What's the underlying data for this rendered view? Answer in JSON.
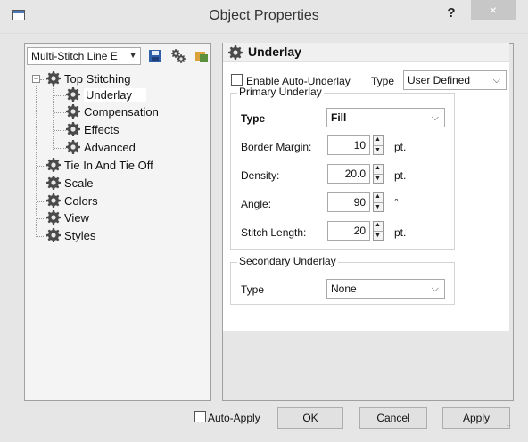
{
  "window": {
    "title": "Object Properties",
    "help_label": "?",
    "close_label": "×"
  },
  "left": {
    "combo_value": "Multi-Stitch Line E",
    "tree": [
      {
        "label": "Top Stitching"
      },
      {
        "label": "Underlay"
      },
      {
        "label": "Compensation"
      },
      {
        "label": "Effects"
      },
      {
        "label": "Advanced"
      },
      {
        "label": "Tie In And Tie Off"
      },
      {
        "label": "Scale"
      },
      {
        "label": "Colors"
      },
      {
        "label": "View"
      },
      {
        "label": "Styles"
      }
    ],
    "selected_item": "Underlay",
    "expander_symbol": "−"
  },
  "panel": {
    "title": "Underlay",
    "enable_auto_label": "Enable Auto-Underlay",
    "enable_auto_checked": false,
    "type_label": "Type",
    "type_value": "User Defined",
    "primary": {
      "legend": "Primary Underlay",
      "type_label": "Type",
      "type_value": "Fill",
      "fields": [
        {
          "label": "Border Margin:",
          "value": "10",
          "unit": "pt."
        },
        {
          "label": "Density:",
          "value": "20.0",
          "unit": "pt."
        },
        {
          "label": "Angle:",
          "value": "90",
          "unit": "°"
        },
        {
          "label": "Stitch Length:",
          "value": "20",
          "unit": "pt."
        }
      ]
    },
    "secondary": {
      "legend": "Secondary Underlay",
      "type_label": "Type",
      "type_value": "None"
    }
  },
  "footer": {
    "auto_apply_label": "Auto-Apply",
    "auto_apply_checked": false,
    "ok_label": "OK",
    "cancel_label": "Cancel",
    "apply_label": "Apply"
  },
  "colors": {
    "gear": "#4a4a4a",
    "close_bg": "#c7c7c7",
    "selection_bg": "#ffffff"
  },
  "icons": [
    "app-icon",
    "save-icon",
    "settings-icon",
    "color-icon",
    "gear-icon",
    "chevron-down-icon",
    "spin-up-icon",
    "spin-down-icon"
  ]
}
